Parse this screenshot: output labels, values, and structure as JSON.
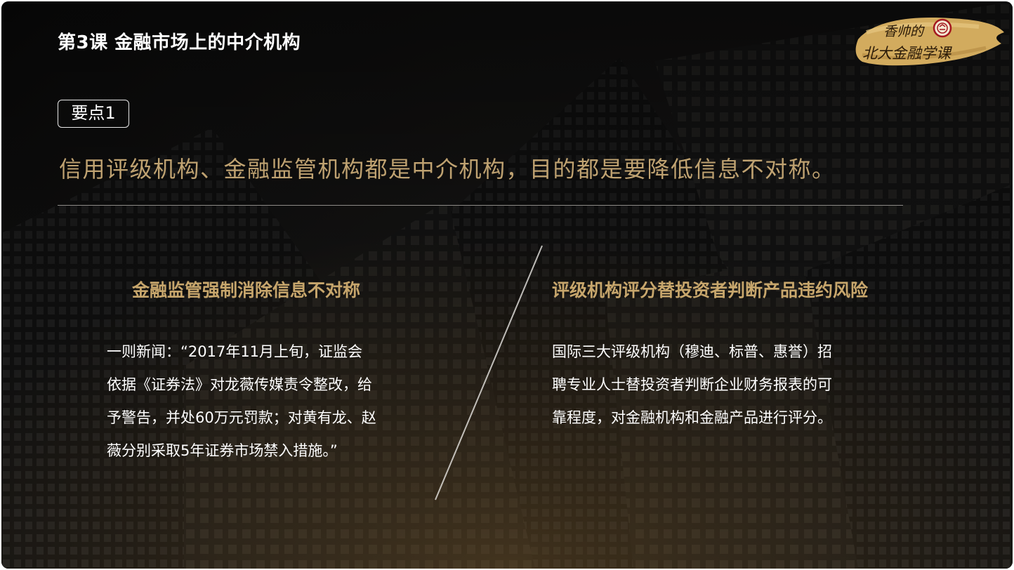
{
  "header": {
    "title": "第3课  金融市场上的中介机构"
  },
  "logo": {
    "line1": "香帅的",
    "line2": "北大金融学课",
    "seal_text": "北大",
    "icon": "peking-university-seal-icon"
  },
  "badge": {
    "label": "要点1"
  },
  "main_statement": "信用评级机构、金融监管机构都是中介机构，目的都是要降低信息不对称。",
  "left_column": {
    "heading": "金融监管强制消除信息不对称",
    "lines": [
      "一则新闻：“2017年11月上旬，证监会",
      "依据《证券法》对龙薇传媒责令整改，给",
      "予警告，并处60万元罚款；对黄有龙、赵",
      "薇分别采取5年证券市场禁入措施。”"
    ]
  },
  "right_column": {
    "heading": "评级机构评分替投资者判断产品违约风险",
    "lines": [
      "国际三大评级机构（穆迪、标普、惠誉）招",
      "聘专业人士替投资者判断企业财务报表的可",
      "靠程度，对金融机构和金融产品进行评分。"
    ]
  },
  "colors": {
    "accent_gold": "#bfa271",
    "heading_gold": "#c7a66c",
    "text_white": "#ffffff",
    "background_dark": "#141414"
  }
}
